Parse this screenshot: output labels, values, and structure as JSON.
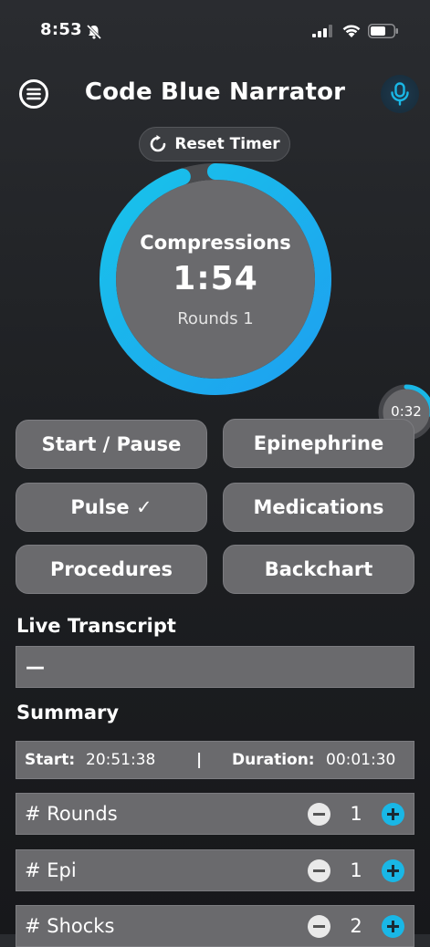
{
  "status_bar": {
    "time": "8:53"
  },
  "header": {
    "title": "Code Blue Narrator"
  },
  "reset": {
    "label": "Reset Timer"
  },
  "timer": {
    "phase": "Compressions",
    "time": "1:54",
    "rounds": "Rounds 1",
    "progress_fraction": 0.95
  },
  "mini_timer": {
    "time": "0:32",
    "progress_fraction": 0.27
  },
  "actions": [
    {
      "label": "Start / Pause"
    },
    {
      "label": "Epinephrine"
    },
    {
      "label": "Pulse ✓"
    },
    {
      "label": "Medications"
    },
    {
      "label": "Procedures"
    },
    {
      "label": "Backchart"
    }
  ],
  "transcript": {
    "heading": "Live Transcript",
    "text": "—"
  },
  "summary": {
    "heading": "Summary",
    "start_label": "Start:",
    "start_value": "20:51:38",
    "separator": "|",
    "duration_label": "Duration:",
    "duration_value": "00:01:30"
  },
  "counters": [
    {
      "label": "# Rounds",
      "value": "1"
    },
    {
      "label": "# Epi",
      "value": "1"
    },
    {
      "label": "# Shocks",
      "value": "2"
    }
  ],
  "colors": {
    "accent": "#19b7e6",
    "ring_start": "#1ea0f0",
    "ring_end": "#18c3ea",
    "button_fill": "#6a6a6d",
    "background": "#1e2023"
  }
}
